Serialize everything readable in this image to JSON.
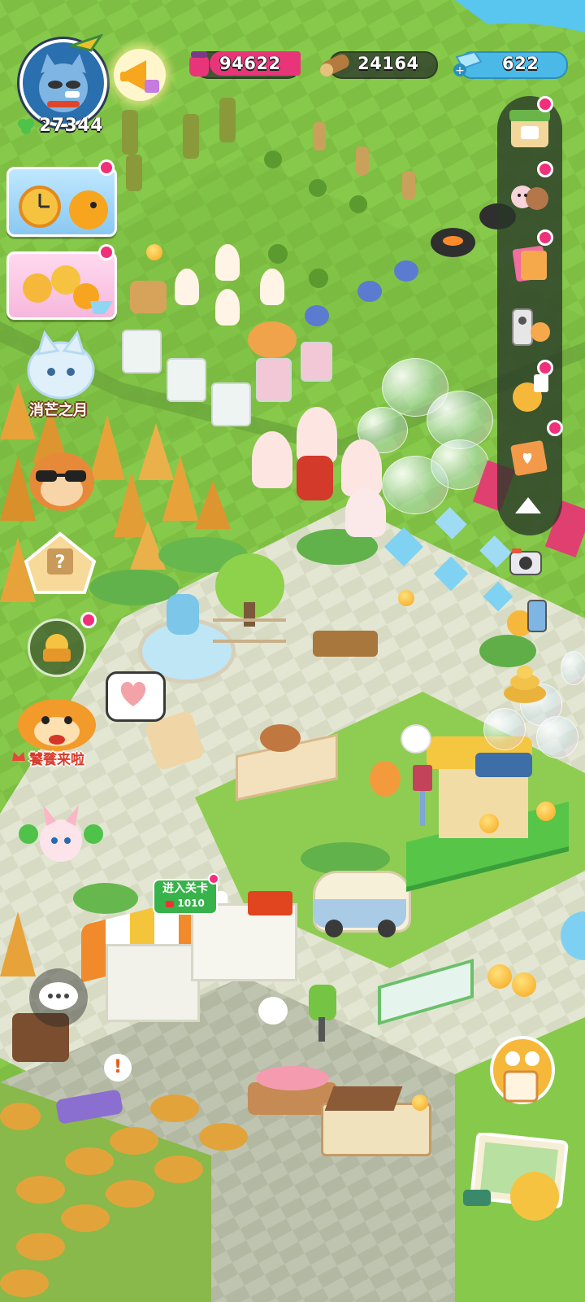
{
  "hud": {
    "player_score": "27344",
    "resources": [
      {
        "name": "jam-jar-icon",
        "value": "94622"
      },
      {
        "name": "wood-log-icon",
        "value": "24164"
      },
      {
        "name": "diamond-icon",
        "value": "622"
      }
    ]
  },
  "left_menu": {
    "event_label": "消芒之月",
    "feast_label": "饕餮来啦"
  },
  "stage_sign": {
    "label": "进入关卡",
    "level": "1010"
  },
  "colors": {
    "grass": "#7cc03e",
    "jam_pill": "#e8357a",
    "gem_pill": "#4bb9e8",
    "notify_badge": "#f0307a",
    "autumn_tree": "#e7a33a"
  }
}
